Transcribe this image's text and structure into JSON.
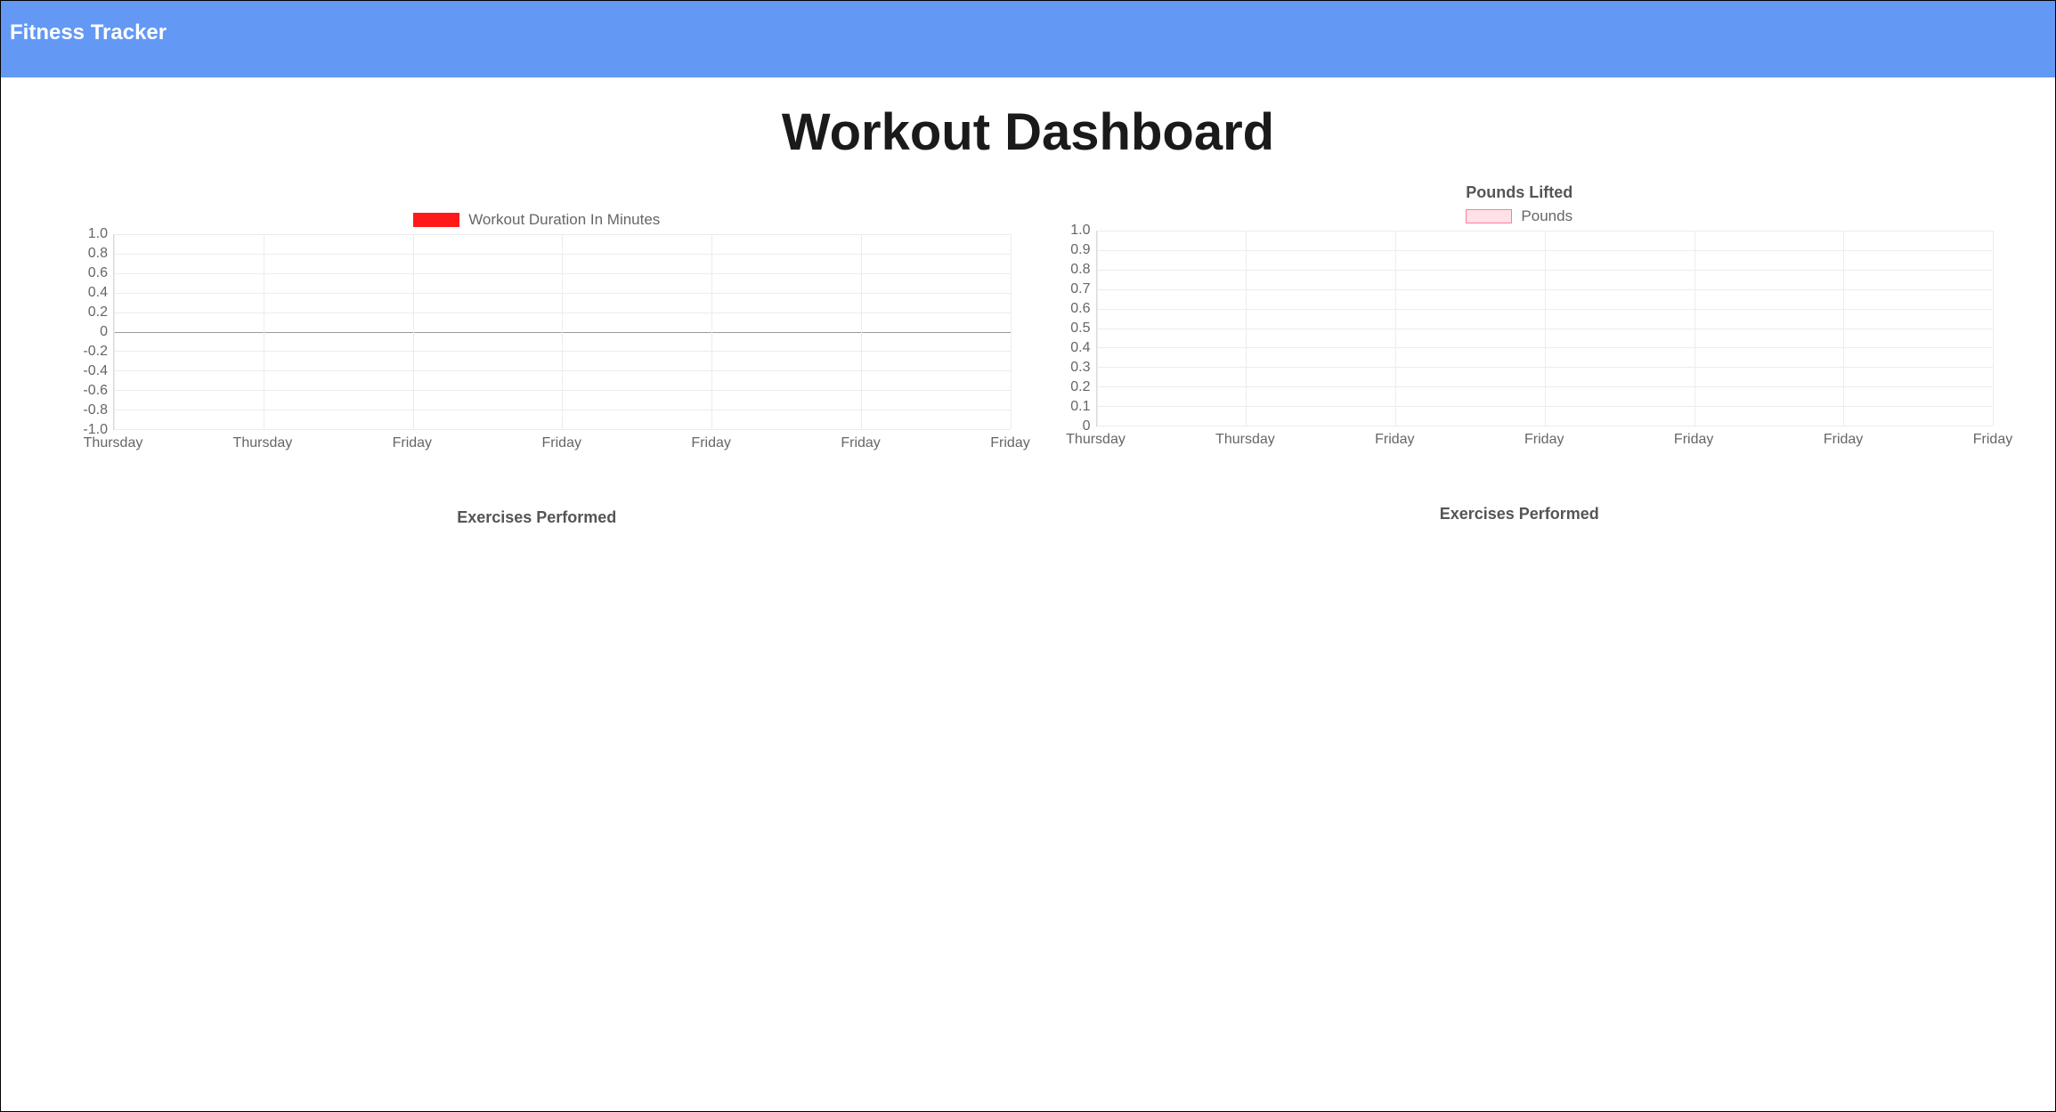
{
  "header": {
    "brand": "Fitness Tracker"
  },
  "page": {
    "title": "Workout Dashboard"
  },
  "panels": {
    "left": {
      "chart_top_title": "",
      "legend_label": "Workout Duration In Minutes",
      "sub_title": "Exercises Performed"
    },
    "right": {
      "chart_top_title": "Pounds Lifted",
      "legend_label": "Pounds",
      "sub_title": "Exercises Performed"
    }
  },
  "chart_data": [
    {
      "id": "duration-chart",
      "type": "line",
      "title": "",
      "legend": [
        "Workout Duration In Minutes"
      ],
      "x_categories": [
        "Thursday",
        "Thursday",
        "Friday",
        "Friday",
        "Friday",
        "Friday",
        "Friday"
      ],
      "y_ticks": [
        1.0,
        0.8,
        0.6,
        0.4,
        0.2,
        0,
        -0.2,
        -0.4,
        -0.6,
        -0.8,
        -1.0
      ],
      "ylim": [
        -1.0,
        1.0
      ],
      "series": [
        {
          "name": "Workout Duration In Minutes",
          "values": []
        }
      ]
    },
    {
      "id": "pounds-chart",
      "type": "bar",
      "title": "Pounds Lifted",
      "legend": [
        "Pounds"
      ],
      "x_categories": [
        "Thursday",
        "Thursday",
        "Friday",
        "Friday",
        "Friday",
        "Friday",
        "Friday"
      ],
      "y_ticks": [
        1.0,
        0.9,
        0.8,
        0.7,
        0.6,
        0.5,
        0.4,
        0.3,
        0.2,
        0.1,
        0
      ],
      "ylim": [
        0,
        1.0
      ],
      "series": [
        {
          "name": "Pounds",
          "values": []
        }
      ]
    }
  ]
}
